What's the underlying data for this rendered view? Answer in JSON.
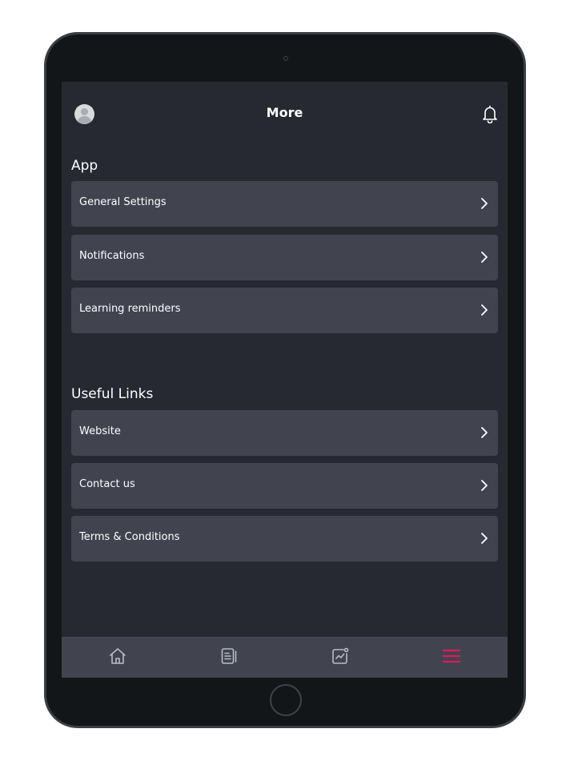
{
  "header": {
    "title": "More",
    "avatar_icon": "user-avatar-icon",
    "notification_icon": "bell-icon"
  },
  "sections": [
    {
      "title": "App",
      "items": [
        {
          "label": "General Settings"
        },
        {
          "label": "Notifications"
        },
        {
          "label": "Learning reminders"
        }
      ]
    },
    {
      "title": "Useful Links",
      "items": [
        {
          "label": "Website"
        },
        {
          "label": "Contact us"
        },
        {
          "label": "Terms & Conditions"
        }
      ]
    }
  ],
  "tabbar": {
    "tabs": [
      {
        "icon": "home-icon",
        "active": false
      },
      {
        "icon": "document-list-icon",
        "active": false
      },
      {
        "icon": "analytics-chart-icon",
        "active": false
      },
      {
        "icon": "hamburger-menu-icon",
        "active": true
      }
    ]
  },
  "colors": {
    "background": "#262930",
    "card": "#41444f",
    "accent": "#e2195b",
    "icon_inactive": "#b8bbc2",
    "text": "#ffffff"
  }
}
